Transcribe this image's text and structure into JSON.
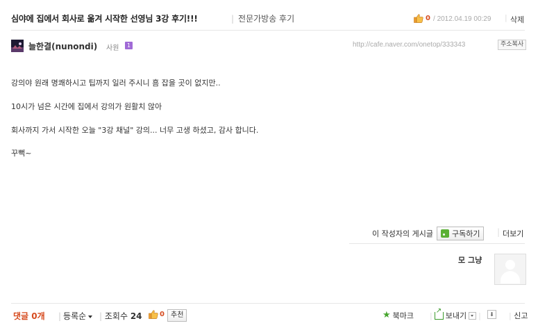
{
  "post": {
    "title": "심야에 집에서 회사로 옮겨 시작한 선영님 3강 후기!!!",
    "category": "전문가방송 후기",
    "like_count": "0",
    "date": "2012.04.19 00:29",
    "delete_label": "삭제"
  },
  "author": {
    "name": "늘한결(nunondi)",
    "grade": "사원",
    "level": "1",
    "url": "http://cafe.naver.com/onetop/333343",
    "copy_label": "주소복사"
  },
  "body": {
    "lines": [
      "강의야 원래 명쾌하시고 팁까지 일러 주시니 흠 잡을 곳이 없지만..",
      "10시가 넘은 시간에 집에서 강의가 원활치 않아",
      "회사까지 가서 시작한 오늘 \"3강 채널\" 강의...  너무 고생 하셨고, 감사 합니다.",
      "꾸뻑~"
    ]
  },
  "subscribe": {
    "prefix": "이 작성자의 게시글",
    "button": "구독하기",
    "more": "더보기"
  },
  "commenter": {
    "name": "모 그냥"
  },
  "footer": {
    "comments": "댓글 0개",
    "sort": "등록순",
    "views_label": "조회수",
    "views_value": "24",
    "like_count": "0",
    "recommend": "추천",
    "bookmark": "북마크",
    "send": "보내기",
    "report": "신고"
  },
  "colors": {
    "accent": "#d64b1f",
    "green": "#46a52e",
    "badge": "#a06ad6"
  }
}
